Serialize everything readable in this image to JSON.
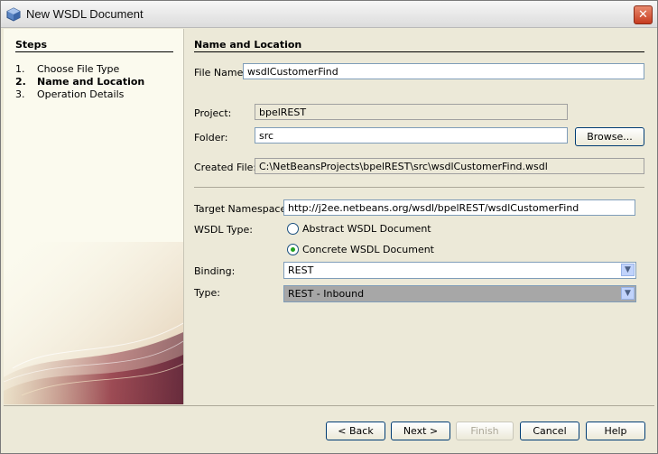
{
  "window": {
    "title": "New WSDL Document"
  },
  "steps": {
    "title": "Steps",
    "items": [
      {
        "num": "1.",
        "label": "Choose File Type"
      },
      {
        "num": "2.",
        "label": "Name and Location"
      },
      {
        "num": "3.",
        "label": "Operation Details"
      }
    ]
  },
  "main": {
    "section_title": "Name and Location",
    "file_name": {
      "label": "File Name:",
      "value": "wsdlCustomerFind"
    },
    "project": {
      "label": "Project:",
      "value": "bpelREST"
    },
    "folder": {
      "label": "Folder:",
      "value": "src",
      "browse_label": "Browse..."
    },
    "created_file": {
      "label": "Created File:",
      "value": "C:\\NetBeansProjects\\bpelREST\\src\\wsdlCustomerFind.wsdl"
    },
    "target_namespace": {
      "label": "Target Namespace:",
      "value": "http://j2ee.netbeans.org/wsdl/bpelREST/wsdlCustomerFind"
    },
    "wsdl_type": {
      "label": "WSDL Type:",
      "options": [
        "Abstract WSDL Document",
        "Concrete WSDL Document"
      ],
      "selected": "Concrete WSDL Document"
    },
    "binding": {
      "label": "Binding:",
      "value": "REST"
    },
    "type": {
      "label": "Type:",
      "value": "REST - Inbound"
    }
  },
  "buttons": {
    "back": "< Back",
    "next": "Next >",
    "finish": "Finish",
    "cancel": "Cancel",
    "help": "Help"
  }
}
